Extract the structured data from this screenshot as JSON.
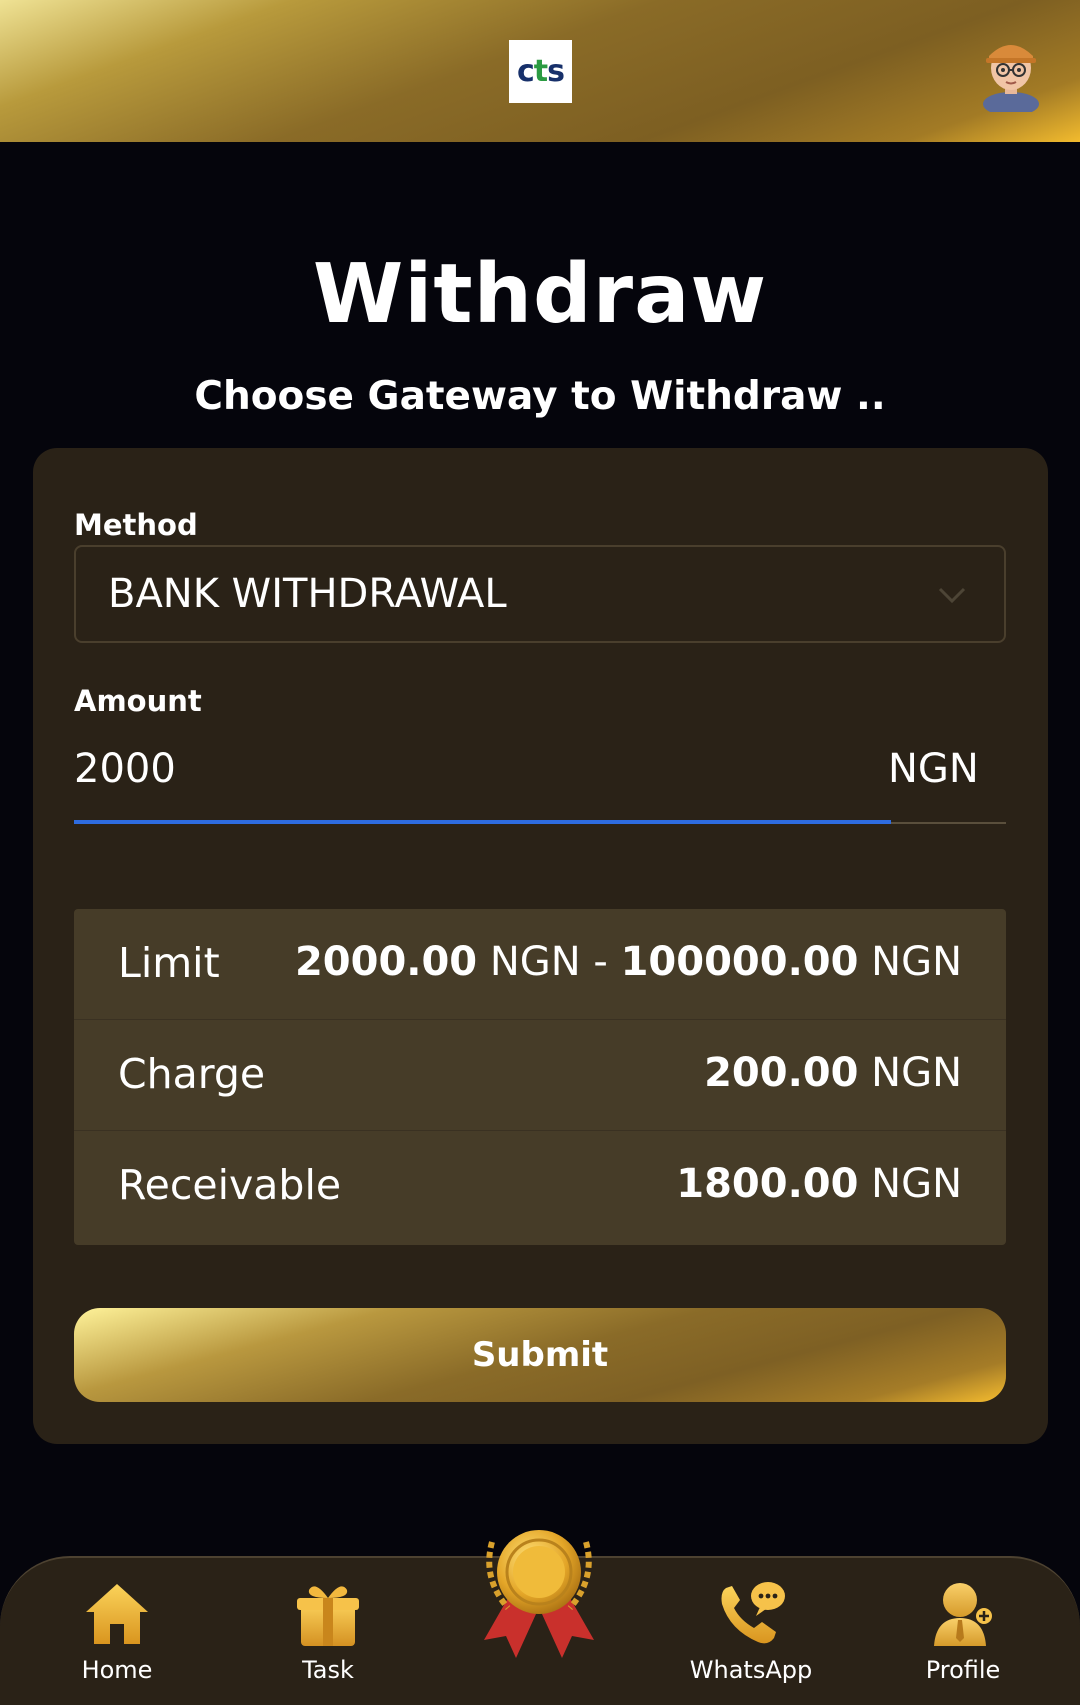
{
  "header": {
    "logo_text_1": "c",
    "logo_text_2": "t",
    "logo_text_3": "s",
    "avatar": "user-avatar-icon"
  },
  "page": {
    "title": "Withdraw",
    "subtitle": "Choose Gateway to Withdraw .."
  },
  "form": {
    "method_label": "Method",
    "method_value": "BANK WITHDRAWAL",
    "amount_label": "Amount",
    "amount_value": "2000",
    "amount_unit": "NGN"
  },
  "info": {
    "limit_label": "Limit",
    "limit_min": "2000.00",
    "limit_min_unit": "NGN",
    "limit_sep": "-",
    "limit_max": "100000.00",
    "limit_max_unit": "NGN",
    "charge_label": "Charge",
    "charge_value": "200.00",
    "charge_unit": "NGN",
    "receivable_label": "Receivable",
    "receivable_value": "1800.00",
    "receivable_unit": "NGN"
  },
  "submit_label": "Submit",
  "nav": {
    "home": "Home",
    "task": "Task",
    "whatsapp": "WhatsApp",
    "profile": "Profile"
  },
  "colors": {
    "accent_gold": "#f2bb2e",
    "card_bg": "#2a2217",
    "input_focus": "#2e6ce0"
  }
}
